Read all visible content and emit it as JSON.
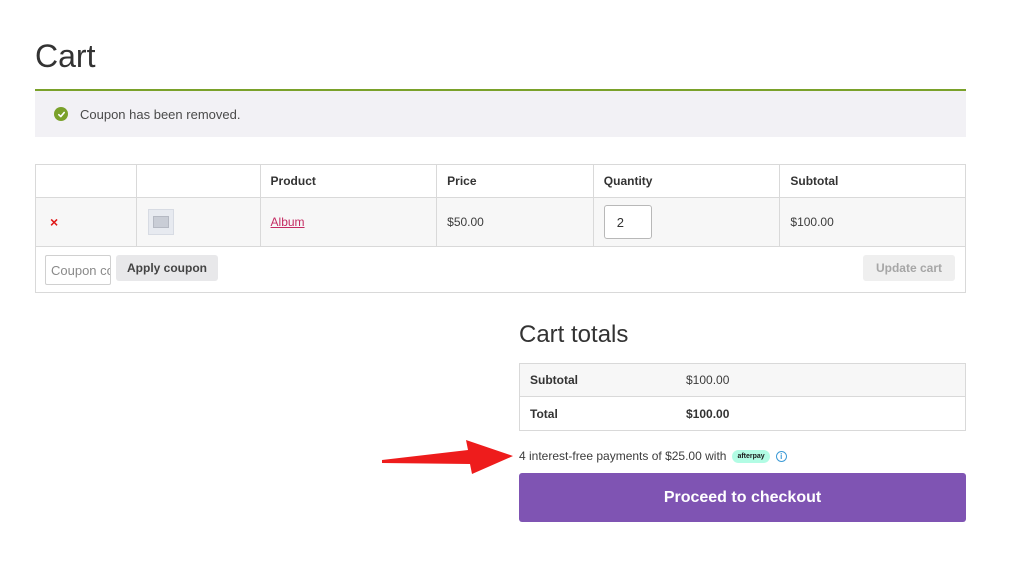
{
  "page": {
    "title": "Cart"
  },
  "notice": {
    "message": "Coupon has been removed.",
    "color": "#7aa12a",
    "icon": "check-circle-icon"
  },
  "cart_table": {
    "headers": [
      "",
      "",
      "Product",
      "Price",
      "Quantity",
      "Subtotal"
    ],
    "items": [
      {
        "remove_icon": "×",
        "thumbnail": "product-thumbnail",
        "product": "Album",
        "price": "$50.00",
        "quantity": "2",
        "subtotal": "$100.00"
      }
    ]
  },
  "coupon": {
    "placeholder": "Coupon code",
    "apply_label": "Apply coupon"
  },
  "update_cart_label": "Update cart",
  "totals": {
    "title": "Cart totals",
    "rows": [
      {
        "label": "Subtotal",
        "value": "$100.00"
      },
      {
        "label": "Total",
        "value": "$100.00"
      }
    ]
  },
  "afterpay": {
    "text": "4 interest-free payments of $25.00 with",
    "badge": "afterpay",
    "info_icon": "info-icon",
    "badge_color": "#b2fce4"
  },
  "checkout": {
    "label": "Proceed to checkout",
    "color": "#7f54b3"
  },
  "annotation": {
    "arrow_color": "#ee1c1c"
  }
}
